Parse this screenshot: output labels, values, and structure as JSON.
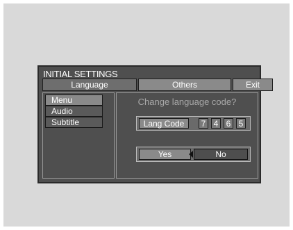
{
  "menu": {
    "title": "INITIAL SETTINGS",
    "tabs": [
      {
        "label": "Language",
        "active": true
      },
      {
        "label": "Others",
        "active": false
      },
      {
        "label": "Exit",
        "active": false
      }
    ],
    "side_items": [
      {
        "label": "Menu",
        "selected": true
      },
      {
        "label": "Audio",
        "selected": false
      },
      {
        "label": "Subtitle",
        "selected": false
      }
    ]
  },
  "dialog": {
    "prompt": "Change language code?",
    "code_label": "Lang Code",
    "code_digits": [
      "7",
      "4",
      "6",
      "5"
    ],
    "yes_label": "Yes",
    "no_label": "No",
    "focused_button": "No"
  },
  "colors": {
    "osd_background": "#4f4f4f",
    "highlight": "#8a8a8a",
    "screen_background": "#d9d9d9"
  }
}
